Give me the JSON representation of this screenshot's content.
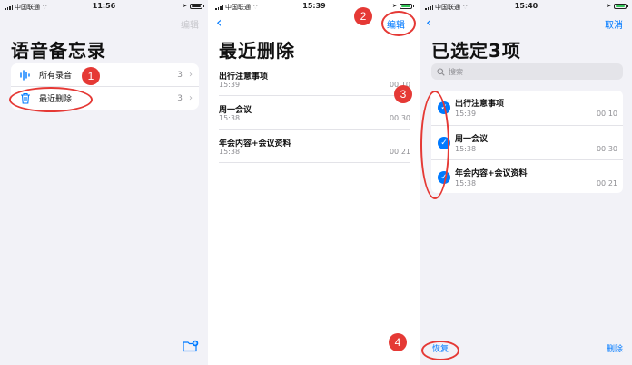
{
  "status_bar": [
    {
      "carrier": "中国联通",
      "time": "11:56"
    },
    {
      "carrier": "中国联通",
      "time": "15:39"
    },
    {
      "carrier": "中国联通",
      "time": "15:40"
    }
  ],
  "screen1": {
    "nav_right": "编辑",
    "title": "语音备忘录",
    "rows": [
      {
        "label": "所有录音",
        "count": "3"
      },
      {
        "label": "最近删除",
        "count": "3"
      }
    ]
  },
  "screen2": {
    "nav_right": "编辑",
    "title": "最近删除",
    "recordings": [
      {
        "title": "出行注意事项",
        "date": "15:39",
        "duration": "00:10"
      },
      {
        "title": "周一会议",
        "date": "15:38",
        "duration": "00:30"
      },
      {
        "title": "年会内容+会议资料",
        "date": "15:38",
        "duration": "00:21"
      }
    ]
  },
  "screen3": {
    "nav_right": "取消",
    "title": "已选定3项",
    "search_placeholder": "搜索",
    "recordings": [
      {
        "title": "出行注意事项",
        "date": "15:39",
        "duration": "00:10"
      },
      {
        "title": "周一会议",
        "date": "15:38",
        "duration": "00:30"
      },
      {
        "title": "年会内容+会议资料",
        "date": "15:38",
        "duration": "00:21"
      }
    ],
    "toolbar": {
      "recover": "恢复",
      "delete": "删除"
    }
  },
  "annotations": [
    "1",
    "2",
    "3",
    "4"
  ],
  "colors": {
    "accent": "#007aff",
    "annotation": "#e53935",
    "secondary_text": "#8e8e93",
    "disabled": "#c7c7cc"
  },
  "icons": [
    "waveform-icon",
    "trash-icon",
    "new-folder-icon",
    "back-chevron-icon",
    "search-icon",
    "checkmark-icon"
  ]
}
